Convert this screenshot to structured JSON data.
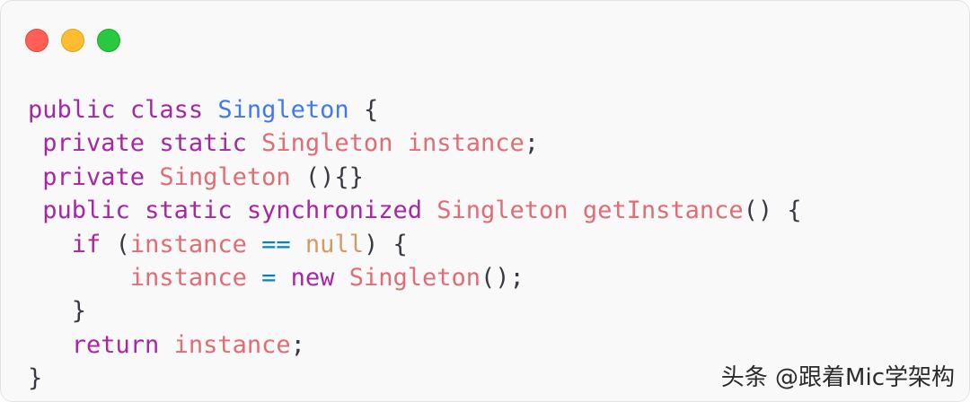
{
  "window": {
    "controls": {
      "close_color": "#ff5f57",
      "minimize_color": "#febc2e",
      "zoom_color": "#28c840"
    }
  },
  "code": {
    "line1": {
      "indent": "",
      "t1": "public",
      "s1": " ",
      "t2": "class",
      "s2": " ",
      "t3": "Singleton",
      "s3": " ",
      "t4": "{"
    },
    "line2": {
      "indent": " ",
      "t1": "private",
      "s1": " ",
      "t2": "static",
      "s2": " ",
      "t3": "Singleton",
      "s3": " ",
      "t4": "instance",
      "t5": ";"
    },
    "line3": {
      "indent": " ",
      "t1": "private",
      "s1": " ",
      "t2": "Singleton",
      "s2": " ",
      "t3": "(){}"
    },
    "line4": {
      "indent": " ",
      "t1": "public",
      "s1": " ",
      "t2": "static",
      "s2": " ",
      "t3": "synchronized",
      "s3": " ",
      "t4": "Singleton",
      "s4": " ",
      "t5": "getInstance",
      "t6": "() {"
    },
    "line5": {
      "indent": "   ",
      "t1": "if",
      "s1": " ",
      "t2": "(",
      "t3": "instance",
      "s2": " ",
      "t4": "==",
      "s3": " ",
      "t5": "null",
      "t6": ") {"
    },
    "line6": {
      "indent": "       ",
      "t1": "instance",
      "s1": " ",
      "t2": "=",
      "s2": " ",
      "t3": "new",
      "s3": " ",
      "t4": "Singleton",
      "t5": "();"
    },
    "line7": {
      "indent": "   ",
      "t1": "}"
    },
    "line8": {
      "indent": "   ",
      "t1": "return",
      "s1": " ",
      "t2": "instance",
      "t3": ";"
    },
    "line9": {
      "indent": "",
      "t1": "}"
    }
  },
  "watermark": "头条 @跟着Mic学架构"
}
